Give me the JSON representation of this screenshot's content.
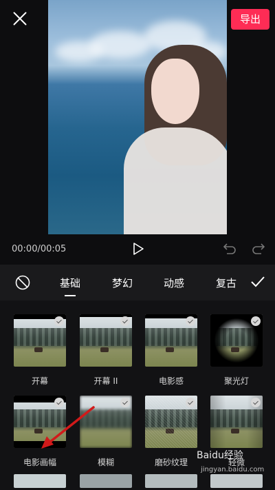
{
  "header": {
    "export_label": "导出"
  },
  "player": {
    "time": "00:00/00:05"
  },
  "tabs": [
    {
      "label": "基础"
    },
    {
      "label": "梦幻"
    },
    {
      "label": "动感"
    },
    {
      "label": "复古"
    }
  ],
  "effects": [
    {
      "label": "开幕"
    },
    {
      "label": "开幕 II"
    },
    {
      "label": "电影感"
    },
    {
      "label": "聚光灯"
    },
    {
      "label": "电影画幅"
    },
    {
      "label": "模糊"
    },
    {
      "label": "磨砂纹理"
    },
    {
      "label": "轻微"
    }
  ],
  "watermark": {
    "text": "Baidu经验",
    "sub": "jingyan.baidu.com"
  },
  "colors": {
    "export_button": "#fe2c55",
    "annotation_arrow": "#d11a1a"
  }
}
